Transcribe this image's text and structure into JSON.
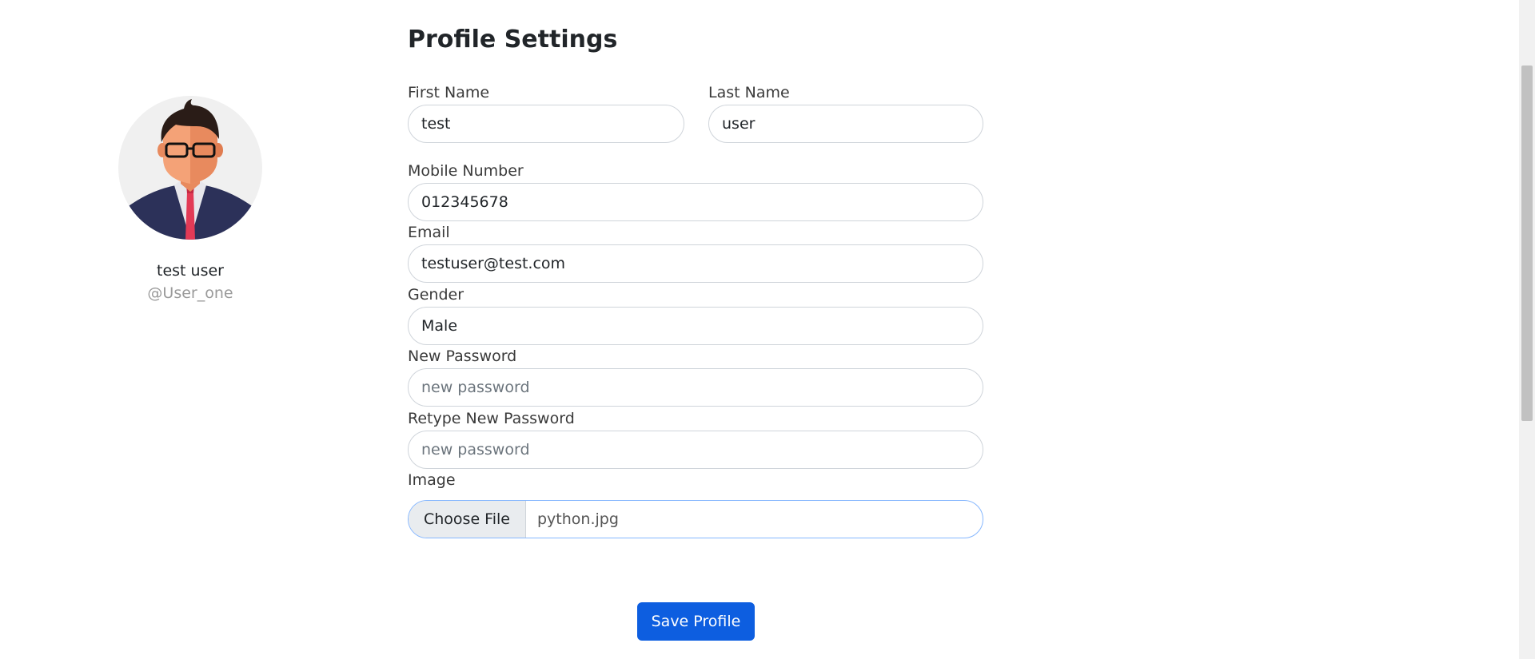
{
  "profile": {
    "display_name": "test user",
    "username": "@User_one"
  },
  "form": {
    "title": "Profile Settings",
    "first_name": {
      "label": "First Name",
      "value": "test"
    },
    "last_name": {
      "label": "Last Name",
      "value": "user"
    },
    "mobile": {
      "label": "Mobile Number",
      "value": "012345678"
    },
    "email": {
      "label": "Email",
      "value": "testuser@test.com"
    },
    "gender": {
      "label": "Gender",
      "value": "Male"
    },
    "new_password": {
      "label": "New Password",
      "value": "",
      "placeholder": "new password"
    },
    "retype_password": {
      "label": "Retype New Password",
      "value": "",
      "placeholder": "new password"
    },
    "image": {
      "label": "Image",
      "button_label": "Choose File",
      "file_name": "python.jpg"
    },
    "save_label": "Save Profile"
  },
  "colors": {
    "primary_button": "#0d5ee0",
    "input_border": "#cfd4da",
    "file_input_focus_border": "#86b7fe",
    "muted_text": "#9a9a9a"
  },
  "icons": {
    "avatar": "businessman-avatar-illustration"
  }
}
